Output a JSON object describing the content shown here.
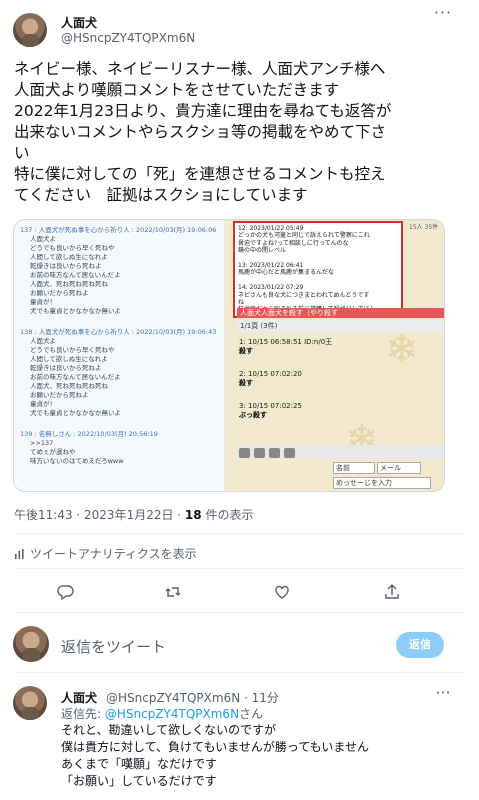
{
  "tweet": {
    "display_name": "人面犬",
    "handle": "@HSncpZY4TQPXm6N",
    "text": "ネイビー様、ネイビーリスナー様、人面犬アンチ様へ\n人面犬より嘆願コメントをさせていただきます\n2022年1月23日より、貴方達に理由を尋ねても返答が\n出来ないコメントやらスクショ等の掲載をやめて下さ\nい\n特に僕に対しての「死」を連想させるコメントも控え\nてください　証拠はスクショにしています",
    "timestamp": "午後11:43 · 2023年1月22日 · ",
    "count": "18",
    "count_label": " 件の表示",
    "analytics_label": "ツイートアナリティクスを表示"
  },
  "media": {
    "left_posts": [
      {
        "head": "137 : 人面犬が死ぬ事を心から祈り人 : 2022/10/03(月) 19:06:06",
        "lines": [
          "人面犬よ",
          "どうでも良いから早く死ねや",
          "人間して欲しぬ生になれよ",
          "乾燥きは良いから死ねよ",
          "お前の味方なんて居ないんだよ",
          "人面犬、死ね死ね死ね死ね",
          "お願いだから死ねよ",
          "童貞が！",
          "犬でも童貞とかなかなか無いよ"
        ]
      },
      {
        "head": "138 : 人面犬が死ぬ事を心から祈り人 : 2022/10/03(月) 19:06:43",
        "lines": [
          "人面犬よ",
          "どうでも良いから早く死ねや",
          "人間して欲しぬ生になれよ",
          "乾燥きは良いから死ねよ",
          "お前の味方なんて居ないんだよ",
          "人面犬、死ね死ね死ね死ね",
          "お願いだから死ねよ",
          "童貞が！",
          "犬でも童貞とかなかなか無いよ"
        ]
      },
      {
        "head": "139 : 名無しさん : 2022/10/03(月) 20:56:19",
        "lines": [
          ">>137",
          "てめぇが運ねや",
          "味方いないのはてめえだろwww"
        ]
      }
    ],
    "right_box": "12: 2023/01/22 05:49\nどっかの犬も河童と同じで訴えられて警察にこれ\n脅迫ですよね?って相談しに行ってんのな\n鏡の中の閉レベル\n\n13: 2023/01/22 06:41\n馬鹿が中心だと馬鹿が集まるんだな\n\n14: 2023/01/22 07:29\nネビさんも良な犬につきまとわれてめんどうです\nね\n狂犬病だから喘まれる前に捕獲して殺処分してほし\nいです",
    "right_meta": "15人 35件",
    "thread_title": "人面犬人面犬を殺す（やり殺す",
    "thread_sub": "1/1頁 (3件)",
    "posts": [
      {
        "head": "1: 10/15 06:58:51 ID:n/0王",
        "body": "殺す"
      },
      {
        "head": "2: 10/15 07:02:20",
        "body": "殺す"
      },
      {
        "head": "3: 10/15 07:02:25",
        "body": "ぶっ殺す"
      }
    ],
    "name_field": "名前",
    "mail_field": "メール",
    "message_field": "めっせーじを入力"
  },
  "actions": [
    "reply-icon",
    "retweet-icon",
    "like-icon",
    "share-icon"
  ],
  "composer": {
    "placeholder": "返信をツイート",
    "reply_button": "返信"
  },
  "reply": {
    "display_name": "人面犬",
    "handle_time": "@HSncpZY4TQPXm6N · 11分",
    "replying_prefix": "返信先: ",
    "replying_to": "@HSncpZY4TQPXm6N",
    "replying_suffix": "さん",
    "text": "それと、勘違いして欲しくないのですが\n僕は貴方に対して、負けてもいませんが勝ってもいません\nあくまで「嘆願」なだけです\n「お願い」しているだけです"
  }
}
